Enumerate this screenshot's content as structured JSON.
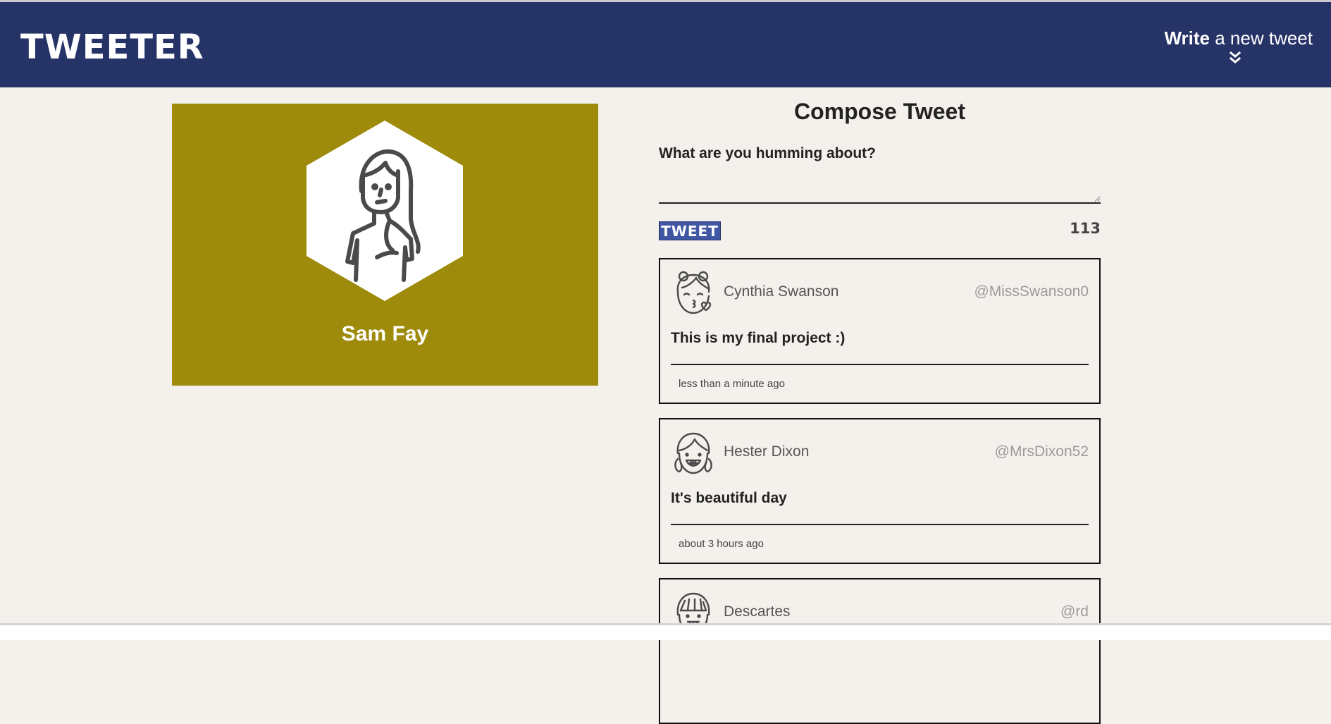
{
  "header": {
    "logo": "TWEETER",
    "write_bold": "Write",
    "write_rest": " a new tweet"
  },
  "profile": {
    "name": "Sam Fay",
    "bg_color": "#9e8a0b"
  },
  "compose": {
    "title": "Compose Tweet",
    "label": "What are you humming about?",
    "input_value": "",
    "button_label": "TWEET",
    "counter": "113"
  },
  "tweets": [
    {
      "name": "Cynthia Swanson",
      "handle": "@MissSwanson0",
      "content": "This is my final project :)",
      "time": "less than a minute ago",
      "avatar_icon": "girl-kiss-icon"
    },
    {
      "name": "Hester Dixon",
      "handle": "@MrsDixon52",
      "content": "It's beautiful day",
      "time": "about 3 hours ago",
      "avatar_icon": "girl-braids-smile-icon"
    },
    {
      "name": "Descartes",
      "handle": "@rd",
      "content": "",
      "time": "",
      "avatar_icon": "girl-bangs-icon"
    }
  ],
  "colors": {
    "nav": "#263367",
    "button": "#4057a4",
    "background": "#f4f1ec"
  }
}
